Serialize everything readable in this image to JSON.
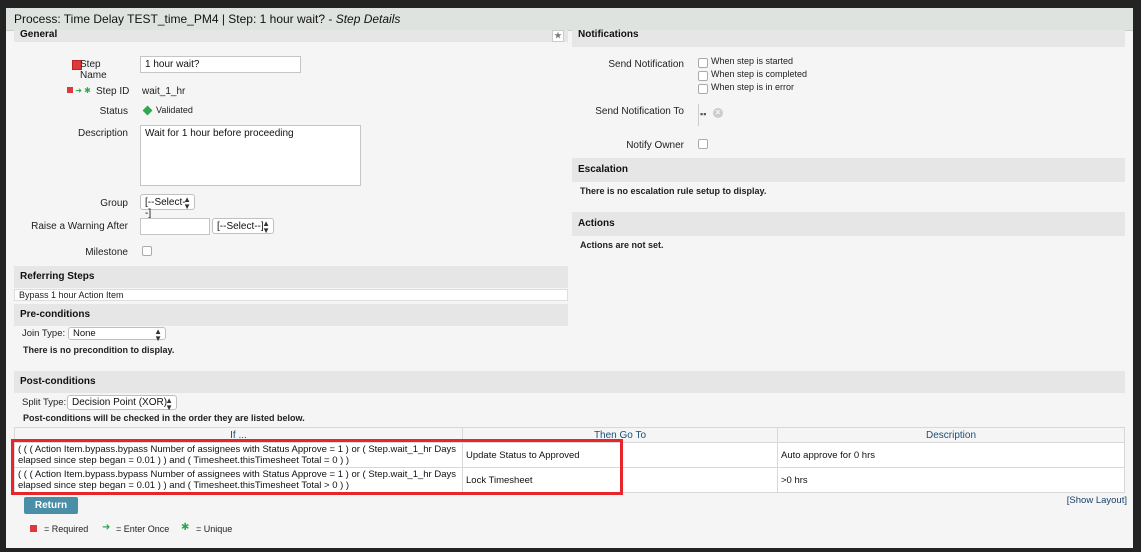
{
  "window": {
    "title_main": "Process: Time Delay TEST_time_PM4 | Step: 1 hour wait? - ",
    "title_italic": "Step Details"
  },
  "general": {
    "header": "General",
    "step_name_label": "Step Name",
    "step_name_value": "1 hour wait?",
    "step_id_label": "Step ID",
    "step_id_value": "wait_1_hr",
    "status_label": "Status",
    "status_value": "Validated",
    "description_label": "Description",
    "description_value": "Wait for 1 hour before proceeding",
    "group_label": "Group",
    "group_value": "[--Select--]",
    "warning_label": "Raise a Warning After",
    "warning_input": "",
    "warning_select": "[--Select--]",
    "milestone_label": "Milestone"
  },
  "referring_steps": {
    "header": "Referring Steps",
    "item": "Bypass 1 hour Action Item"
  },
  "preconditions": {
    "header": "Pre-conditions",
    "join_label": "Join Type:",
    "join_value": "None",
    "empty": "There is no precondition to display."
  },
  "notifications": {
    "header": "Notifications",
    "send_label": "Send Notification",
    "options": [
      "When step is started",
      "When step is completed",
      "When step is in error"
    ],
    "send_to_label": "Send Notification To",
    "notify_owner_label": "Notify Owner"
  },
  "escalation": {
    "header": "Escalation",
    "empty": "There is no escalation rule setup to display."
  },
  "actions": {
    "header": "Actions",
    "empty": "Actions are not set."
  },
  "postconditions": {
    "header": "Post-conditions",
    "split_label": "Split Type:",
    "split_value": "Decision Point (XOR)",
    "note": "Post-conditions will be checked in the order they are listed below.",
    "columns": [
      "If ...",
      "Then Go To",
      "Description"
    ],
    "rows": [
      {
        "cond_line1": "( ( ( Action Item.bypass.bypass Number of assignees with Status Approve = 1 ) or ( Step.wait_1_hr Days",
        "cond_line2": "elapsed since step began = 0.01 ) ) and ( Timesheet.thisTimesheet Total = 0 ) )",
        "goto": "Update Status to Approved",
        "desc": "Auto approve for 0 hrs"
      },
      {
        "cond_line1": "( ( ( Action Item.bypass.bypass Number of assignees with Status Approve = 1 ) or ( Step.wait_1_hr Days",
        "cond_line2": "elapsed since step began = 0.01 ) ) and ( Timesheet.thisTimesheet Total > 0 ) )",
        "goto": "Lock Timesheet",
        "desc": ">0 hrs"
      }
    ]
  },
  "footer": {
    "return_label": "Return",
    "show_layout": "[Show Layout]",
    "legend_required": "= Required",
    "legend_enter_once": "= Enter Once",
    "legend_unique": "= Unique"
  },
  "colors": {
    "accent": "#4a8ea8",
    "required": "#e0393b",
    "enter_once": "#2fa84f",
    "highlight": "#e8252a"
  }
}
